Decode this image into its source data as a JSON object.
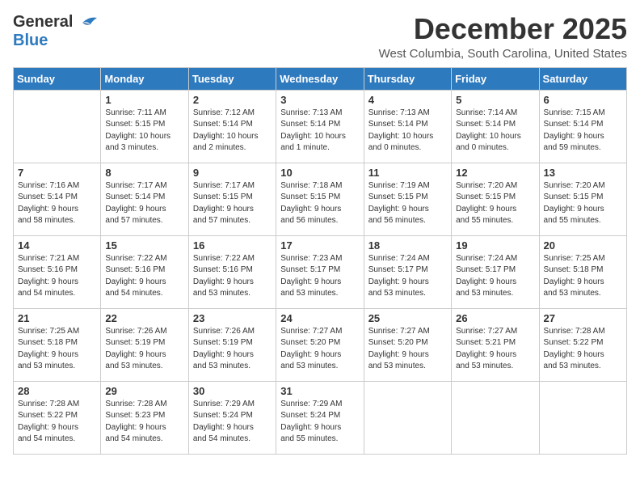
{
  "logo": {
    "line1": "General",
    "line2": "Blue"
  },
  "title": "December 2025",
  "location": "West Columbia, South Carolina, United States",
  "days_header": [
    "Sunday",
    "Monday",
    "Tuesday",
    "Wednesday",
    "Thursday",
    "Friday",
    "Saturday"
  ],
  "weeks": [
    [
      {
        "num": "",
        "info": ""
      },
      {
        "num": "1",
        "info": "Sunrise: 7:11 AM\nSunset: 5:15 PM\nDaylight: 10 hours\nand 3 minutes."
      },
      {
        "num": "2",
        "info": "Sunrise: 7:12 AM\nSunset: 5:14 PM\nDaylight: 10 hours\nand 2 minutes."
      },
      {
        "num": "3",
        "info": "Sunrise: 7:13 AM\nSunset: 5:14 PM\nDaylight: 10 hours\nand 1 minute."
      },
      {
        "num": "4",
        "info": "Sunrise: 7:13 AM\nSunset: 5:14 PM\nDaylight: 10 hours\nand 0 minutes."
      },
      {
        "num": "5",
        "info": "Sunrise: 7:14 AM\nSunset: 5:14 PM\nDaylight: 10 hours\nand 0 minutes."
      },
      {
        "num": "6",
        "info": "Sunrise: 7:15 AM\nSunset: 5:14 PM\nDaylight: 9 hours\nand 59 minutes."
      }
    ],
    [
      {
        "num": "7",
        "info": "Sunrise: 7:16 AM\nSunset: 5:14 PM\nDaylight: 9 hours\nand 58 minutes."
      },
      {
        "num": "8",
        "info": "Sunrise: 7:17 AM\nSunset: 5:14 PM\nDaylight: 9 hours\nand 57 minutes."
      },
      {
        "num": "9",
        "info": "Sunrise: 7:17 AM\nSunset: 5:15 PM\nDaylight: 9 hours\nand 57 minutes."
      },
      {
        "num": "10",
        "info": "Sunrise: 7:18 AM\nSunset: 5:15 PM\nDaylight: 9 hours\nand 56 minutes."
      },
      {
        "num": "11",
        "info": "Sunrise: 7:19 AM\nSunset: 5:15 PM\nDaylight: 9 hours\nand 56 minutes."
      },
      {
        "num": "12",
        "info": "Sunrise: 7:20 AM\nSunset: 5:15 PM\nDaylight: 9 hours\nand 55 minutes."
      },
      {
        "num": "13",
        "info": "Sunrise: 7:20 AM\nSunset: 5:15 PM\nDaylight: 9 hours\nand 55 minutes."
      }
    ],
    [
      {
        "num": "14",
        "info": "Sunrise: 7:21 AM\nSunset: 5:16 PM\nDaylight: 9 hours\nand 54 minutes."
      },
      {
        "num": "15",
        "info": "Sunrise: 7:22 AM\nSunset: 5:16 PM\nDaylight: 9 hours\nand 54 minutes."
      },
      {
        "num": "16",
        "info": "Sunrise: 7:22 AM\nSunset: 5:16 PM\nDaylight: 9 hours\nand 53 minutes."
      },
      {
        "num": "17",
        "info": "Sunrise: 7:23 AM\nSunset: 5:17 PM\nDaylight: 9 hours\nand 53 minutes."
      },
      {
        "num": "18",
        "info": "Sunrise: 7:24 AM\nSunset: 5:17 PM\nDaylight: 9 hours\nand 53 minutes."
      },
      {
        "num": "19",
        "info": "Sunrise: 7:24 AM\nSunset: 5:17 PM\nDaylight: 9 hours\nand 53 minutes."
      },
      {
        "num": "20",
        "info": "Sunrise: 7:25 AM\nSunset: 5:18 PM\nDaylight: 9 hours\nand 53 minutes."
      }
    ],
    [
      {
        "num": "21",
        "info": "Sunrise: 7:25 AM\nSunset: 5:18 PM\nDaylight: 9 hours\nand 53 minutes."
      },
      {
        "num": "22",
        "info": "Sunrise: 7:26 AM\nSunset: 5:19 PM\nDaylight: 9 hours\nand 53 minutes."
      },
      {
        "num": "23",
        "info": "Sunrise: 7:26 AM\nSunset: 5:19 PM\nDaylight: 9 hours\nand 53 minutes."
      },
      {
        "num": "24",
        "info": "Sunrise: 7:27 AM\nSunset: 5:20 PM\nDaylight: 9 hours\nand 53 minutes."
      },
      {
        "num": "25",
        "info": "Sunrise: 7:27 AM\nSunset: 5:20 PM\nDaylight: 9 hours\nand 53 minutes."
      },
      {
        "num": "26",
        "info": "Sunrise: 7:27 AM\nSunset: 5:21 PM\nDaylight: 9 hours\nand 53 minutes."
      },
      {
        "num": "27",
        "info": "Sunrise: 7:28 AM\nSunset: 5:22 PM\nDaylight: 9 hours\nand 53 minutes."
      }
    ],
    [
      {
        "num": "28",
        "info": "Sunrise: 7:28 AM\nSunset: 5:22 PM\nDaylight: 9 hours\nand 54 minutes."
      },
      {
        "num": "29",
        "info": "Sunrise: 7:28 AM\nSunset: 5:23 PM\nDaylight: 9 hours\nand 54 minutes."
      },
      {
        "num": "30",
        "info": "Sunrise: 7:29 AM\nSunset: 5:24 PM\nDaylight: 9 hours\nand 54 minutes."
      },
      {
        "num": "31",
        "info": "Sunrise: 7:29 AM\nSunset: 5:24 PM\nDaylight: 9 hours\nand 55 minutes."
      },
      {
        "num": "",
        "info": ""
      },
      {
        "num": "",
        "info": ""
      },
      {
        "num": "",
        "info": ""
      }
    ]
  ]
}
